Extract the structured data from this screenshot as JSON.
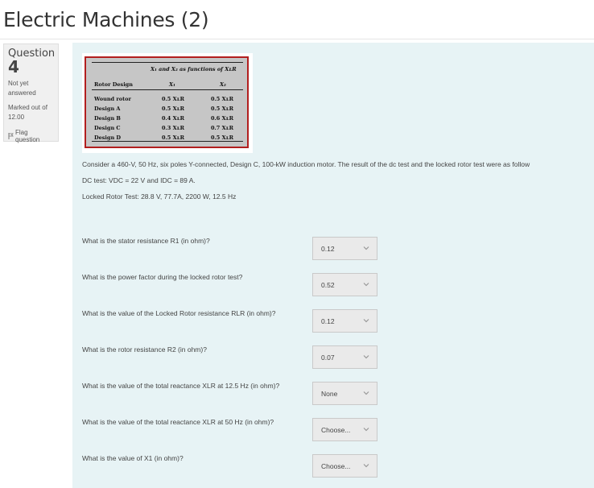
{
  "page": {
    "title": "Electric Machines (2)"
  },
  "question_info": {
    "label": "Question",
    "number": "4",
    "state": "Not yet answered",
    "grade": "Marked out of 12.00",
    "flag_label": "Flag question"
  },
  "table": {
    "title": "X₁ and X₂ as functions of XʟR",
    "col_design": "Rotor Design",
    "col_x1": "X₁",
    "col_x2": "X₂",
    "rows": [
      {
        "design": "Wound rotor",
        "x1": "0.5 XʟR",
        "x2": "0.5 XʟR"
      },
      {
        "design": "Design A",
        "x1": "0.5 XʟR",
        "x2": "0.5 XʟR"
      },
      {
        "design": "Design B",
        "x1": "0.4 XʟR",
        "x2": "0.6 XʟR"
      },
      {
        "design": "Design C",
        "x1": "0.3 XʟR",
        "x2": "0.7 XʟR"
      },
      {
        "design": "Design D",
        "x1": "0.5 XʟR",
        "x2": "0.5 XʟR"
      }
    ]
  },
  "text": {
    "intro": "Consider a 460-V, 50 Hz, six poles Y-connected, Design C, 100-kW induction motor. The result of the dc test and the locked rotor test were as follow",
    "dc_test": "DC test: VDC = 22 V and IDC = 89 A.",
    "locked_test": "Locked Rotor Test: 28.8 V, 77.7A, 2200 W, 12.5 Hz"
  },
  "questions": [
    {
      "text": "What is the stator resistance R1 (in ohm)?",
      "answer": "0.12"
    },
    {
      "text": "What is the power factor during the locked rotor test?",
      "answer": "0.52"
    },
    {
      "text": "What is the value of the Locked Rotor resistance RLR (in ohm)?",
      "answer": "0.12"
    },
    {
      "text": "What is the rotor resistance R2 (in ohm)?",
      "answer": "0.07"
    },
    {
      "text": "What is the value of the total reactance XLR at 12.5 Hz (in ohm)?",
      "answer": "None"
    },
    {
      "text": "What is the value of the total reactance XLR at 50 Hz (in ohm)?",
      "answer": "Choose..."
    },
    {
      "text": "What is the value of X1 (in ohm)?",
      "answer": "Choose..."
    }
  ]
}
